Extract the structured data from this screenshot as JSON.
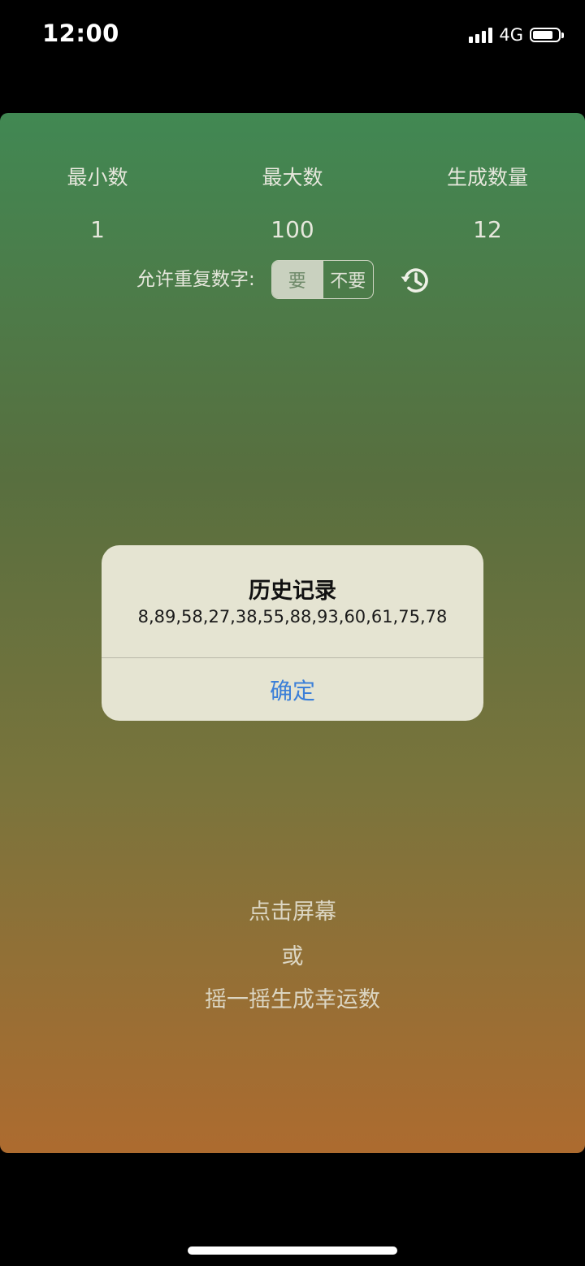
{
  "status_bar": {
    "time": "12:00",
    "network": "4G",
    "icons": [
      "signal-icon",
      "battery-icon"
    ]
  },
  "settings": {
    "min_label": "最小数",
    "min_value": "1",
    "max_label": "最大数",
    "max_value": "100",
    "count_label": "生成数量",
    "count_value": "12"
  },
  "repeat": {
    "label": "允许重复数字:",
    "options": [
      "要",
      "不要"
    ],
    "selected": "要"
  },
  "history_icon": "history-icon",
  "hint": {
    "line1": "点击屏幕",
    "line2": "或",
    "line3": "摇一摇生成幸运数"
  },
  "dialog": {
    "title": "历史记录",
    "message": "8,89,58,27,38,55,88,93,60,61,75,78",
    "ok_label": "确定"
  },
  "colors": {
    "gradient_top": "#418853",
    "gradient_bottom": "#ad6b2f",
    "accent_blue": "#3b7fd8",
    "dialog_bg": "#e5e4d2"
  }
}
